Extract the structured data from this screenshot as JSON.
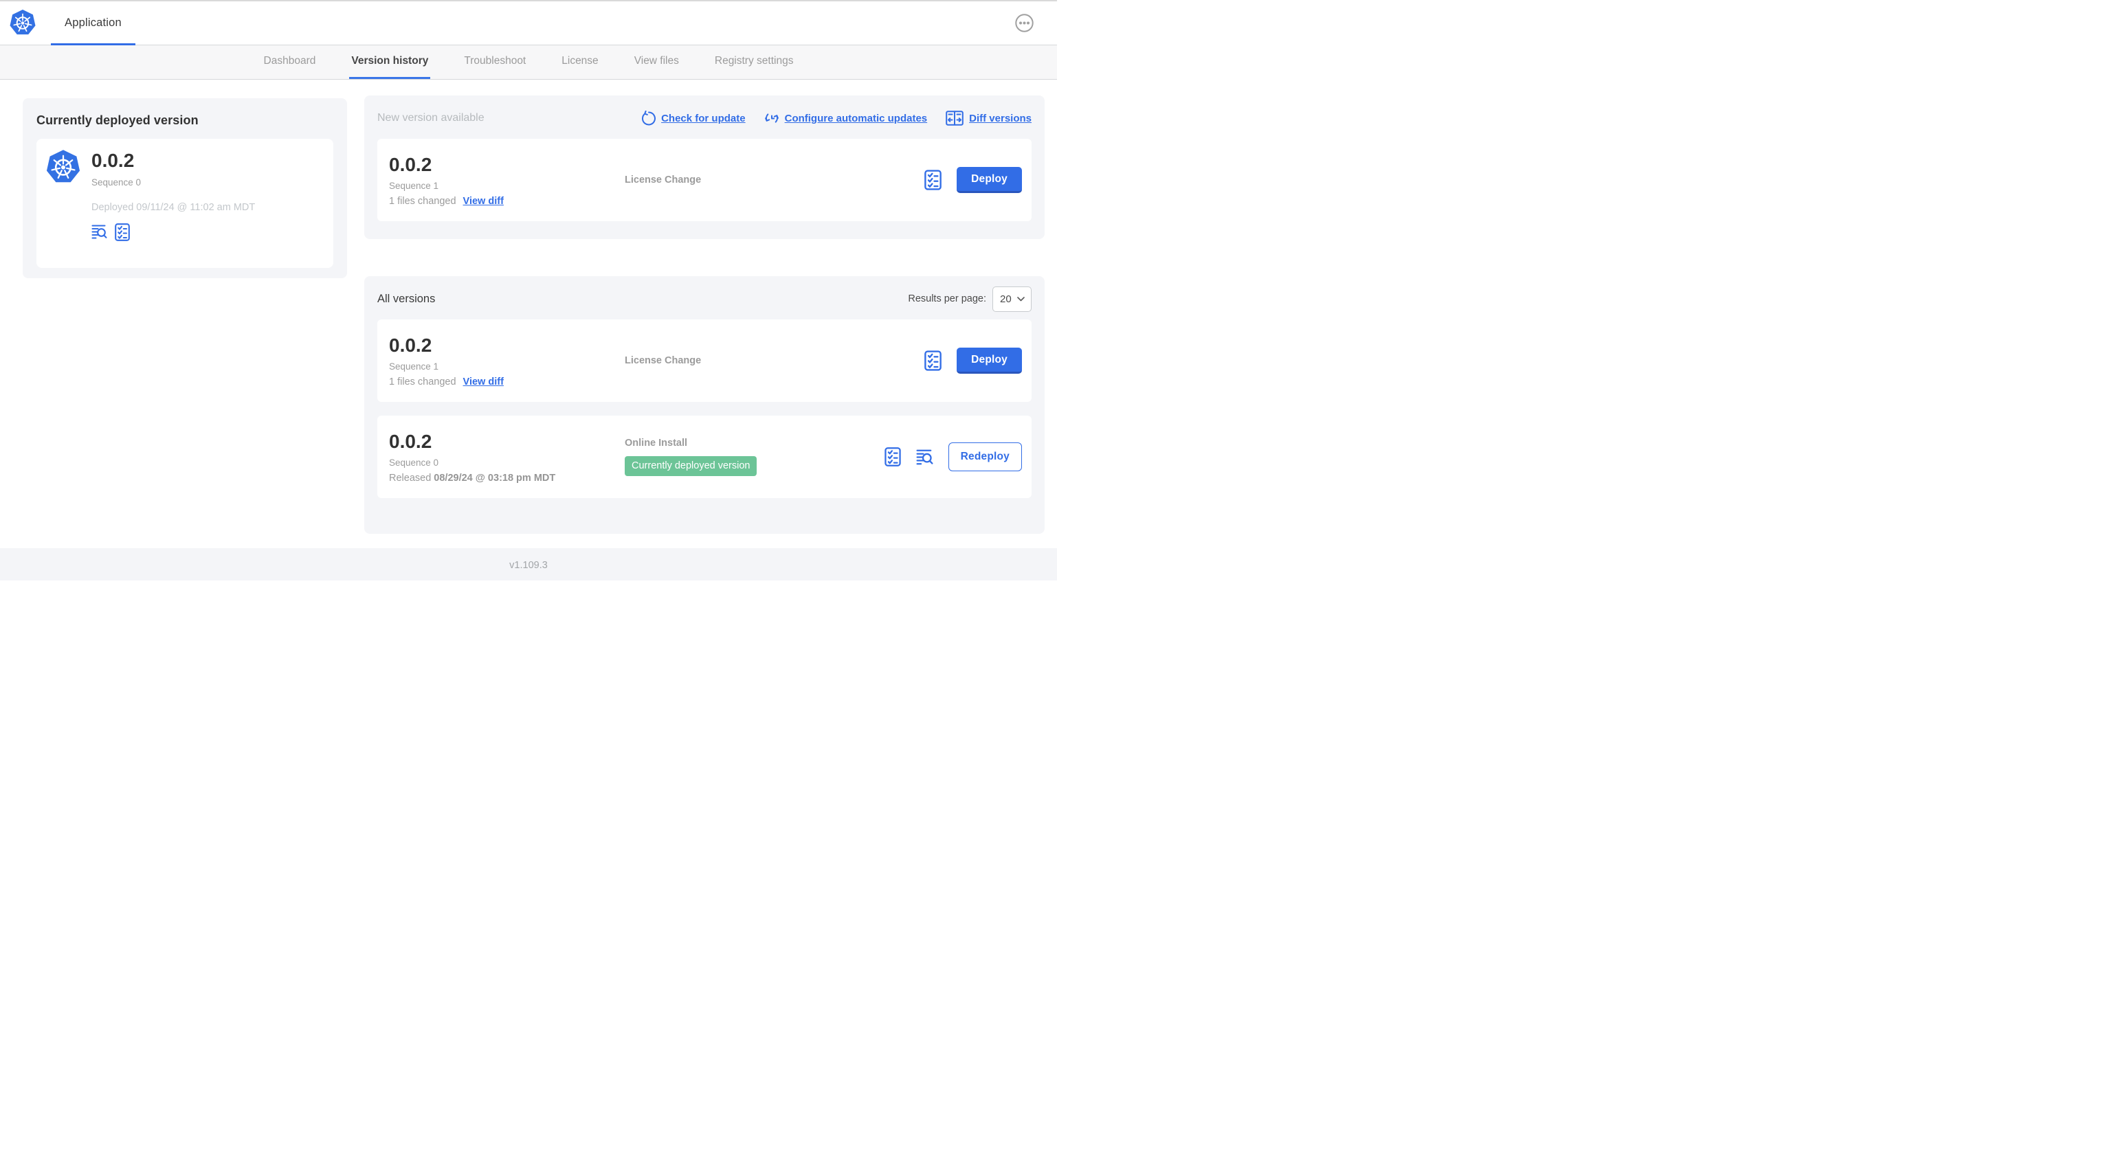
{
  "header": {
    "app_tab": "Application"
  },
  "nav": {
    "tabs": [
      {
        "label": "Dashboard",
        "active": false
      },
      {
        "label": "Version history",
        "active": true
      },
      {
        "label": "Troubleshoot",
        "active": false
      },
      {
        "label": "License",
        "active": false
      },
      {
        "label": "View files",
        "active": false
      },
      {
        "label": "Registry settings",
        "active": false
      }
    ]
  },
  "current_version_card": {
    "title": "Currently deployed version",
    "version": "0.0.2",
    "sequence": "Sequence 0",
    "deployed": "Deployed 09/11/24 @ 11:02 am MDT"
  },
  "new_version_section": {
    "title": "New version available",
    "actions": [
      {
        "label": "Check for update",
        "icon": "refresh-icon"
      },
      {
        "label": "Configure automatic updates",
        "icon": "auto-update-icon"
      },
      {
        "label": "Diff versions",
        "icon": "diff-icon"
      }
    ],
    "row": {
      "version": "0.0.2",
      "sequence": "Sequence 1",
      "files_changed": "1 files changed",
      "view_diff_label": "View diff",
      "source": "License Change",
      "action_label": "Deploy"
    }
  },
  "all_versions_section": {
    "title": "All versions",
    "results_per_page_label": "Results per page:",
    "results_per_page_value": "20",
    "rows": [
      {
        "version": "0.0.2",
        "sequence": "Sequence 1",
        "files_changed": "1 files changed",
        "view_diff_label": "View diff",
        "source": "License Change",
        "action_label": "Deploy"
      },
      {
        "version": "0.0.2",
        "sequence": "Sequence 0",
        "released_prefix": "Released ",
        "released_date": "08/29/24 @ 03:18 pm MDT",
        "source": "Online Install",
        "badge": "Currently deployed version",
        "action_label": "Redeploy"
      }
    ]
  },
  "footer": {
    "app_version": "v1.109.3"
  },
  "colors": {
    "accent": "#326de6",
    "badge_green": "#6cc497",
    "card_background": "#f4f5f8"
  }
}
